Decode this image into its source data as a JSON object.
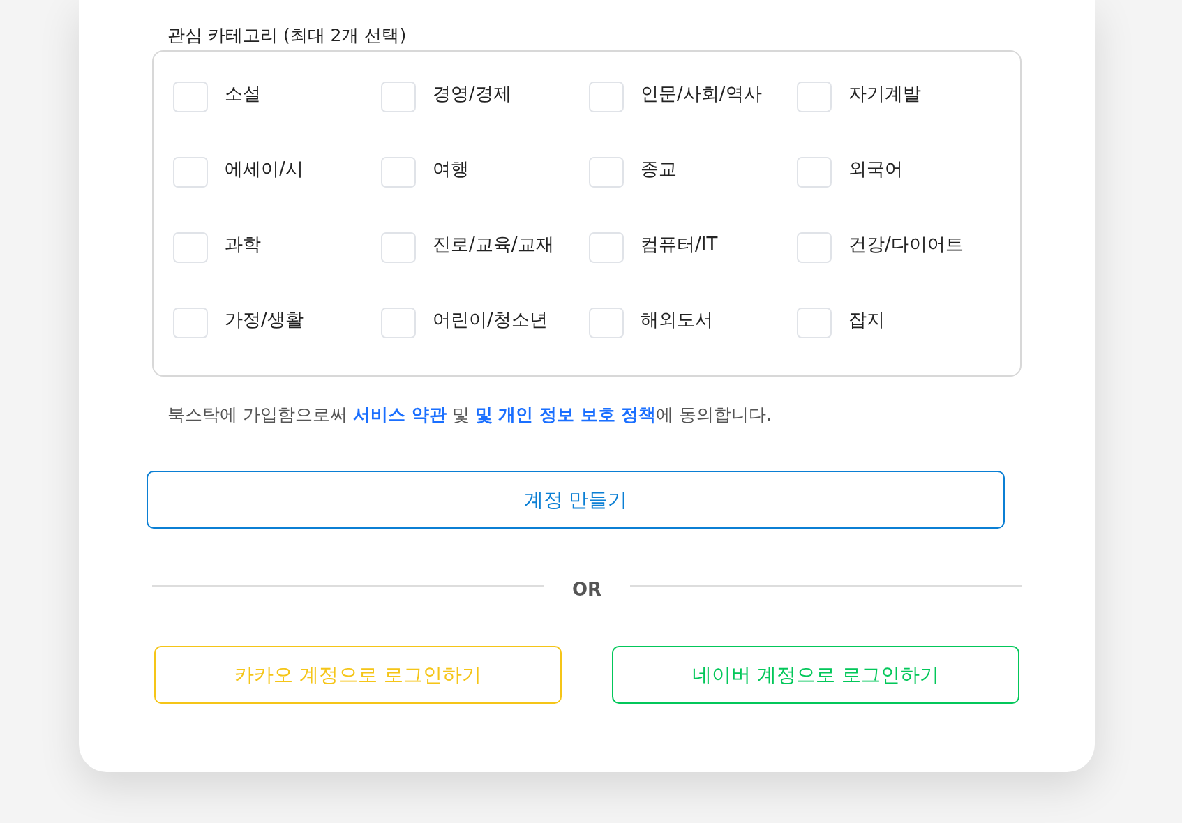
{
  "categories": {
    "label": "관심 카테고리 (최대 2개 선택)",
    "items": [
      {
        "label": "소설",
        "checked": false
      },
      {
        "label": "경영/경제",
        "checked": false
      },
      {
        "label": "인문/사회/역사",
        "checked": false
      },
      {
        "label": "자기계발",
        "checked": false
      },
      {
        "label": "에세이/시",
        "checked": false
      },
      {
        "label": "여행",
        "checked": false
      },
      {
        "label": "종교",
        "checked": false
      },
      {
        "label": "외국어",
        "checked": false
      },
      {
        "label": "과학",
        "checked": false
      },
      {
        "label": "진로/교육/교재",
        "checked": false
      },
      {
        "label": "컴퓨터/IT",
        "checked": false
      },
      {
        "label": "건강/다이어트",
        "checked": false
      },
      {
        "label": "가정/생활",
        "checked": false
      },
      {
        "label": "어린이/청소년",
        "checked": false
      },
      {
        "label": "해외도서",
        "checked": false
      },
      {
        "label": "잡지",
        "checked": false
      }
    ]
  },
  "terms": [
    {
      "kind": "text",
      "text": "북스탁에 가입함으로써 "
    },
    {
      "kind": "link",
      "text": "서비스 약관"
    },
    {
      "kind": "text",
      "text": " 및 "
    },
    {
      "kind": "link",
      "text": "및 개인 정보 보호 정책"
    },
    {
      "kind": "text",
      "text": "에 동의합니다."
    }
  ],
  "create_button": "계정 만들기",
  "divider": "OR",
  "social_buttons": [
    {
      "label": "카카오 계정으로 로그인하기",
      "color": "#f5c518"
    },
    {
      "label": "네이버 계정으로 로그인하기",
      "color": "#03c75a"
    }
  ]
}
